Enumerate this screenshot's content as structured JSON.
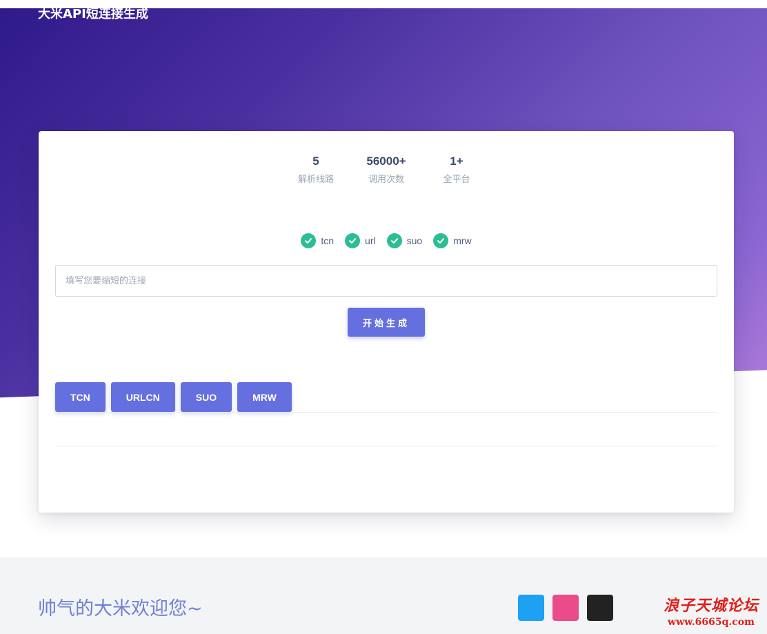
{
  "header": {
    "title": "大米API短连接生成"
  },
  "stats": [
    {
      "value": "5",
      "label": "解析线路"
    },
    {
      "value": "56000+",
      "label": "调用次数"
    },
    {
      "value": "1+",
      "label": "全平台"
    }
  ],
  "services": [
    "tcn",
    "url",
    "suo",
    "mrw"
  ],
  "input": {
    "placeholder": "填写您要缩短的连接",
    "value": ""
  },
  "generate_label": "开始生成",
  "tabs": [
    "TCN",
    "URLCN",
    "SUO",
    "MRW"
  ],
  "footer": {
    "text": "帅气的大米欢迎您~",
    "social": [
      {
        "name": "twitter-icon",
        "color": "#1da1f2"
      },
      {
        "name": "dribbble-icon",
        "color": "#ea4c89"
      },
      {
        "name": "github-icon",
        "color": "#222222"
      }
    ]
  },
  "watermark": {
    "title": "浪子天城论坛",
    "url": "www.6665q.com"
  },
  "colors": {
    "accent": "#6470df",
    "check": "#2dbd96",
    "footer_text": "#6f7fd6"
  }
}
